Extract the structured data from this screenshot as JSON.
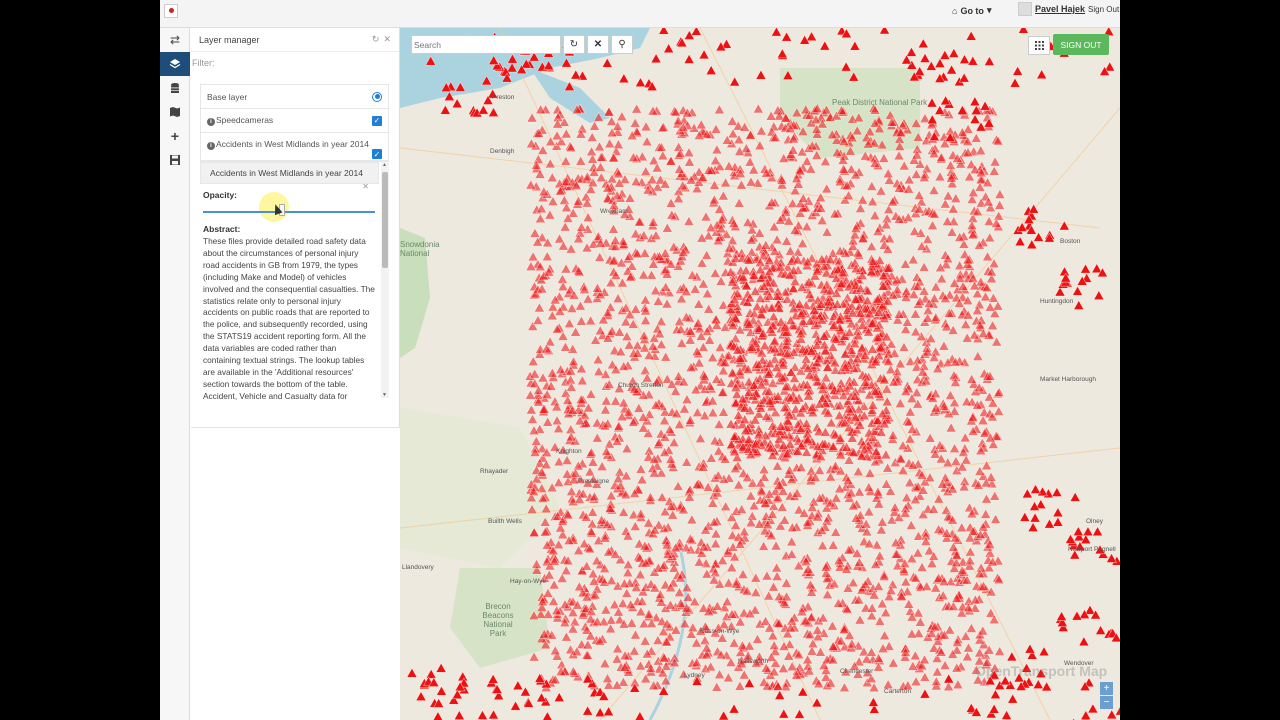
{
  "topbar": {
    "goto_label": "Go to",
    "user_name": "Pavel Hajek",
    "sign_out": "Sign Out"
  },
  "panel": {
    "title": "Layer manager",
    "filter_placeholder": "Filter:",
    "layers": [
      {
        "label": "Base layer",
        "control": "radio"
      },
      {
        "label": "Speedcameras",
        "control": "checkbox",
        "info": true
      },
      {
        "label": "Accidents in West Midlands in year 2014",
        "control": "checkbox",
        "info": true
      }
    ],
    "details": {
      "title": "Accidents in West Midlands in year 2014",
      "opacity_label": "Opacity:",
      "opacity_value": 0.45,
      "abstract_label": "Abstract:",
      "abstract_text": "These files provide detailed road safety data about the circumstances of personal injury road accidents in GB from 1979, the types (including Make and Model) of vehicles involved and the consequential casualties. The statistics relate only to personal injury accidents on public roads that are reported to the police, and subsequently recorded, using the STATS19 accident reporting form. All the data variables are coded rather than containing textual strings. The lookup tables are available in the 'Additional resources' section towards the bottom of the table. Accident, Vehicle and Casualty data for"
    }
  },
  "map": {
    "search_placeholder": "Search",
    "sign_out_button": "SIGN OUT",
    "marker_color": "#ee1111",
    "places": [
      {
        "t": "Peak District National Park",
        "c": "big"
      },
      {
        "t": "Brecon Beacons National Park",
        "c": "big"
      },
      {
        "t": "Snowdonia National",
        "c": "big"
      },
      {
        "t": "Preston"
      },
      {
        "t": "Denbigh"
      },
      {
        "t": "Wrexham"
      },
      {
        "t": "Church Stretton"
      },
      {
        "t": "Builth Wells"
      },
      {
        "t": "Llandovery"
      },
      {
        "t": "Presteigne"
      },
      {
        "t": "Knighton"
      },
      {
        "t": "Hay-on-Wye"
      },
      {
        "t": "Ross-on-Wye"
      },
      {
        "t": "Nailsworth"
      },
      {
        "t": "Cirencester"
      },
      {
        "t": "Carterton"
      },
      {
        "t": "Wendover"
      },
      {
        "t": "Market Harborough"
      },
      {
        "t": "Huntingdon"
      },
      {
        "t": "Boston"
      },
      {
        "t": "Newport Pagnell"
      },
      {
        "t": "Rhayader"
      },
      {
        "t": "Olney"
      },
      {
        "t": "Lydney"
      }
    ],
    "watermark": "OpenTransport Map",
    "zoom_in": "+",
    "zoom_out": "−"
  }
}
